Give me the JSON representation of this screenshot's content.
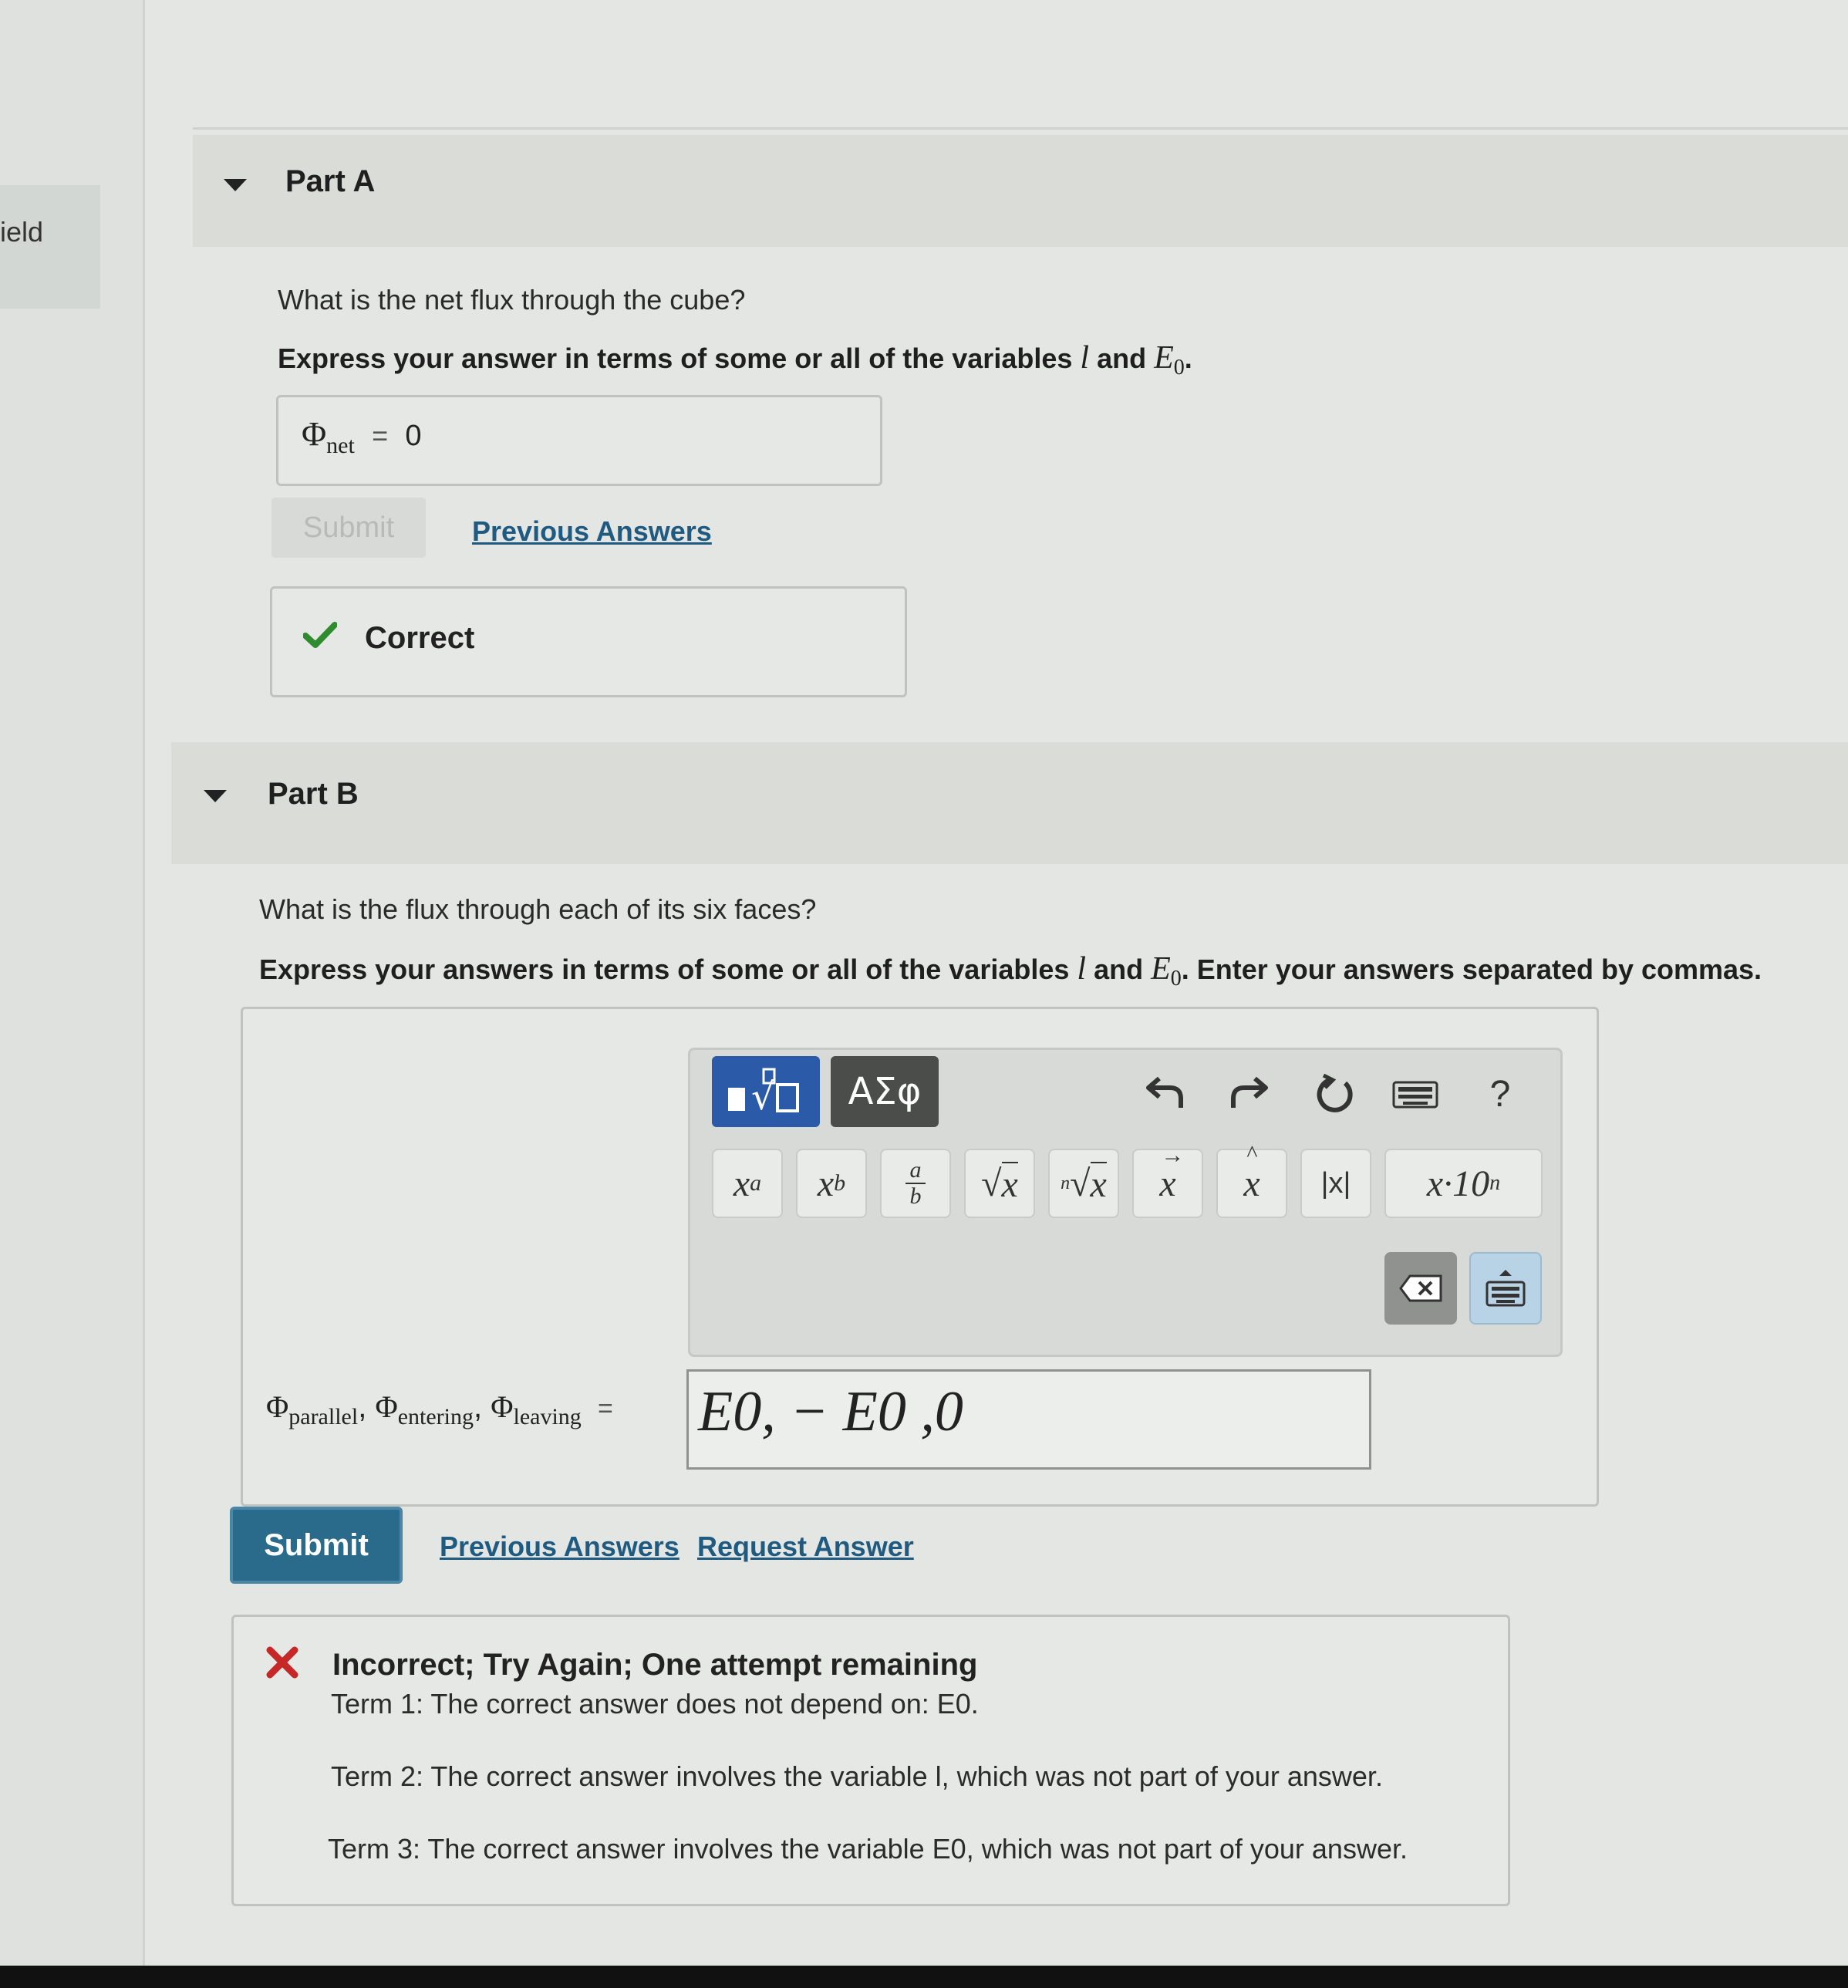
{
  "sidebar": {
    "tab_label": "ield"
  },
  "part_a": {
    "title": "Part A",
    "question": "What is the net flux through the cube?",
    "instruction_pre": "Express your answer in terms of some or all of the variables ",
    "var_l": "l",
    "instruction_and": " and ",
    "var_e0": "E",
    "var_e0_sub": "0",
    "instruction_end": ".",
    "answer_symbol": "Φ",
    "answer_sub": "net",
    "answer_eq": "=",
    "answer_value": "0",
    "submit_label": "Submit",
    "previous_answers": "Previous Answers",
    "feedback": "Correct"
  },
  "part_b": {
    "title": "Part B",
    "question": "What is the flux through each of its six faces?",
    "instruction_pre": "Express your answers in terms of some or all of the variables ",
    "var_l": "l",
    "instruction_and": " and ",
    "var_e0": "E",
    "var_e0_sub": "0",
    "instruction_end": ". Enter your answers separated by commas.",
    "toolbar": {
      "mode_templates_icon": "templates-icon",
      "mode_greek": "ΑΣφ",
      "undo_icon": "undo-icon",
      "redo_icon": "redo-icon",
      "reset_icon": "reset-icon",
      "keyboard_icon": "keyboard-icon",
      "help": "?",
      "buttons": [
        "x^a",
        "x_b",
        "a/b",
        "√x",
        "ⁿ√x",
        "x⃗",
        "x̂",
        "|x|",
        "x·10ⁿ"
      ],
      "delete_icon": "backspace-icon",
      "toggle_keyboard_icon": "keyboard-toggle-icon"
    },
    "answer_label_phi": "Φ",
    "answer_label_sub1": "parallel",
    "answer_label_sub2": "entering",
    "answer_label_sub3": "leaving",
    "answer_sep": ",",
    "answer_eq": "=",
    "answer_value": "E0, − E0 ,0",
    "submit_label": "Submit",
    "previous_answers": "Previous Answers",
    "request_answer": "Request Answer",
    "feedback": {
      "title": "Incorrect; Try Again; One attempt remaining",
      "term1": "Term 1: The correct answer does not depend on: E0.",
      "term2": "Term 2: The correct answer involves the variable l, which was not part of your answer.",
      "term3": "Term 3: The correct answer involves the variable E0, which was not part of your answer."
    }
  },
  "colors": {
    "correct": "#2e8b2e",
    "incorrect": "#c62828",
    "primary_button": "#2a6b8c",
    "link": "#1f5a80",
    "mode_active": "#2a5aa8",
    "mode_inactive": "#4a4d4a"
  }
}
